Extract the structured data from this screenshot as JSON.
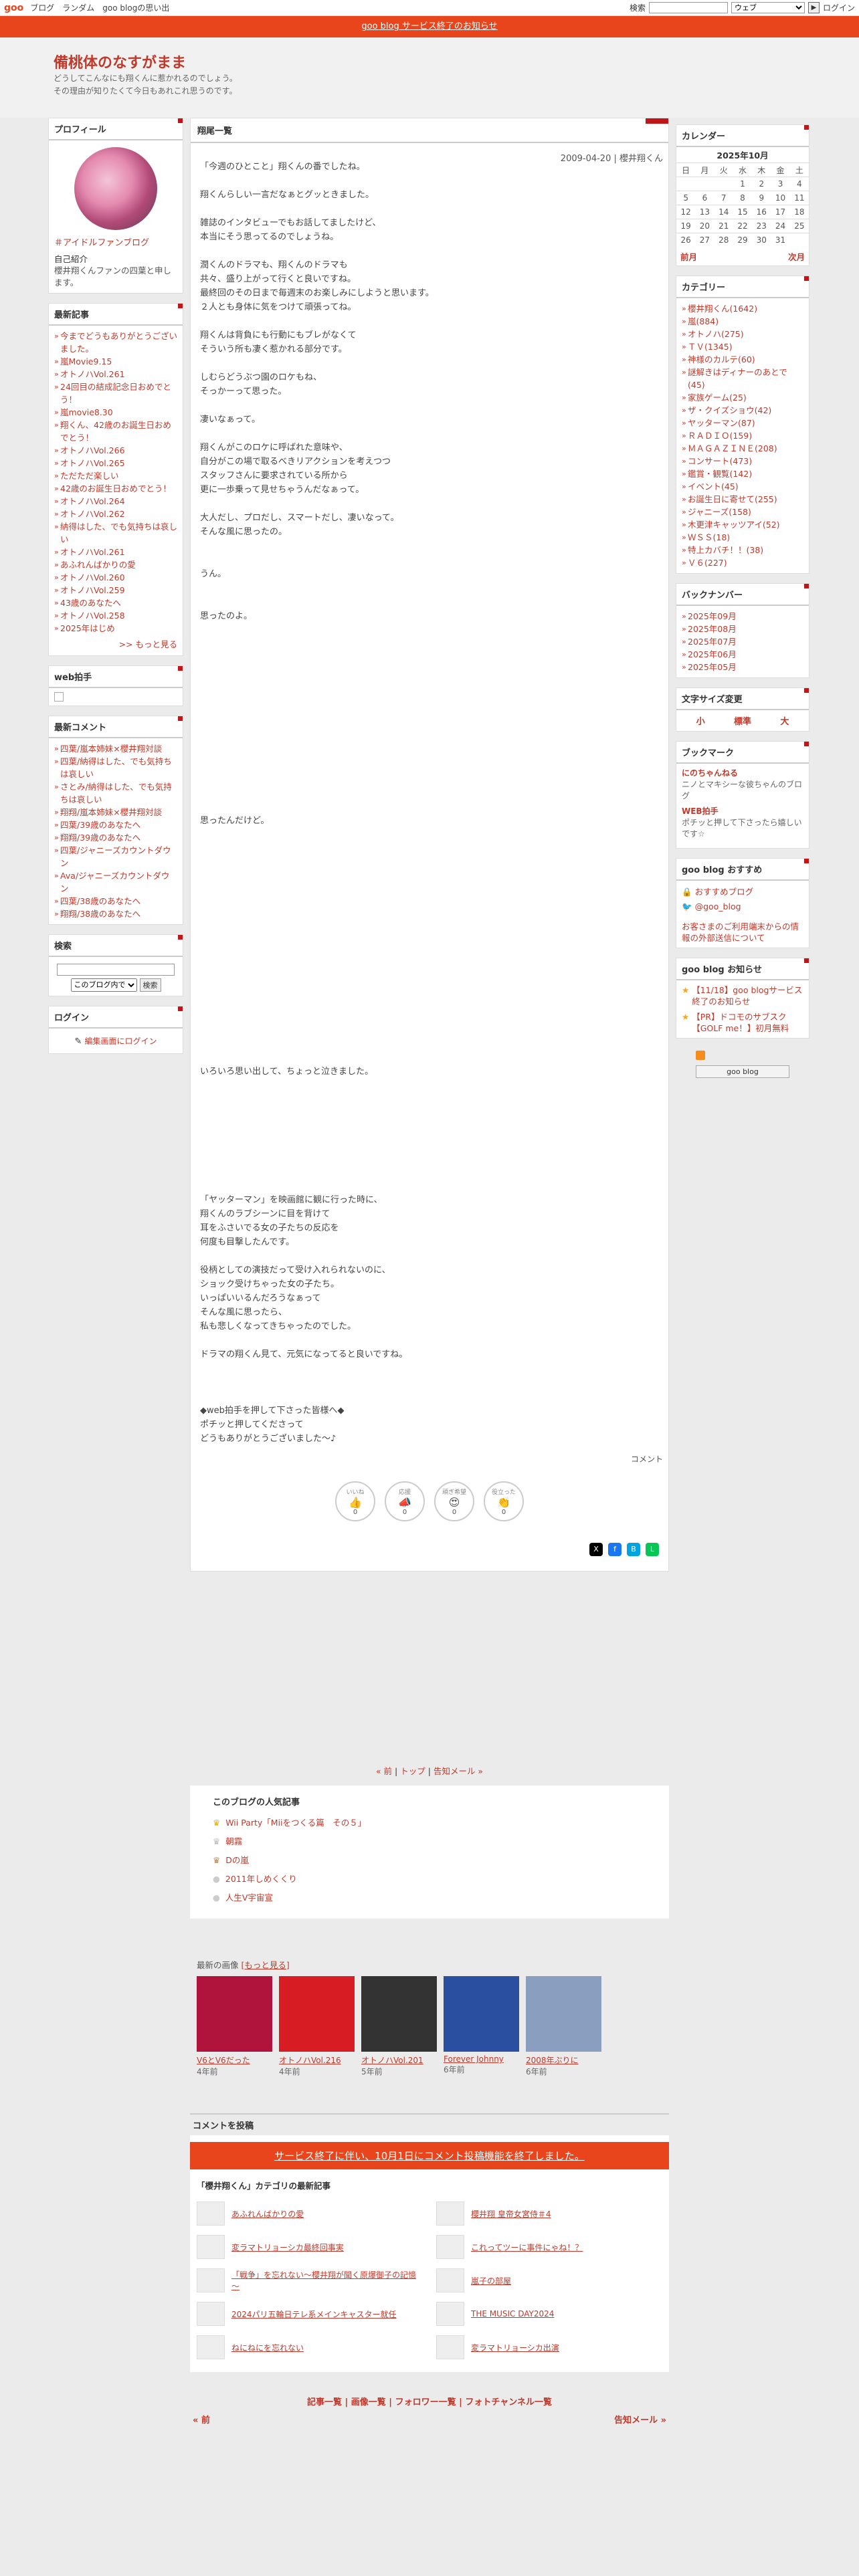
{
  "topbar": {
    "logo": "goo",
    "links": [
      "ブログ",
      "ランダム",
      "goo blogの思い出"
    ],
    "search_label": "検索",
    "search_scope": "ウェブ",
    "go": "▶",
    "login": "ログイン"
  },
  "notice": "goo blog サービス終了のお知らせ",
  "blog": {
    "title": "備桃体のなすがまま",
    "desc1": "どうしてこんなにも翔くんに惹かれるのでしょう。",
    "desc2": "その理由が知りたくて今日もあれこれ思うのです。"
  },
  "profile": {
    "heading": "プロフィール",
    "link": "＃アイドルファンブログ",
    "intro_label": "自己紹介",
    "intro": "櫻井翔くんファンの四葉と申します。"
  },
  "recent": {
    "heading": "最新記事",
    "items": [
      "今までどうもありがとうございました。",
      "嵐Movie9.15",
      "オトノハVol.261",
      "24回目の結成記念日おめでとう！",
      "嵐movie8.30",
      "翔くん、42歳のお誕生日おめでとう！",
      "オトノハVol.266",
      "オトノハVol.265",
      "ただただ楽しい",
      "42歳のお誕生日おめでとう！",
      "オトノハVol.264",
      "オトノハVol.262",
      "納得はした、でも気持ちは哀しい",
      "オトノハVol.261",
      "あふれんばかりの愛",
      "オトノハVol.260",
      "オトノハVol.259",
      "43歳のあなたへ",
      "オトノハVol.258",
      "2025年はじめ"
    ],
    "more": ">> もっと見る"
  },
  "webclap": {
    "heading": "web拍手"
  },
  "comments": {
    "heading": "最新コメント",
    "items": [
      "四葉/嵐本姉妹×櫻井翔対談",
      "四葉/納得はした、でも気持ちは哀しい",
      "さとみ/納得はした、でも気持ちは哀しい",
      "翔翔/嵐本姉妹×櫻井翔対談",
      "四葉/39歳のあなたへ",
      "翔翔/39歳のあなたへ",
      "四葉/ジャニーズカウントダウン",
      "Ava/ジャニーズカウントダウン",
      "四葉/38歳のあなたへ",
      "翔翔/38歳のあなたへ"
    ]
  },
  "search": {
    "heading": "検索",
    "select": "このブログ内で",
    "button": "検索"
  },
  "login": {
    "heading": "ログイン",
    "link": "編集画面にログイン"
  },
  "main": {
    "heading": "翔尾一覧",
    "date": "2009-04-20 | 櫻井翔くん",
    "p1": "「今週のひとこと」翔くんの番でしたね。\n\n翔くんらしい一言だなぁとグッときました。\n\n雑誌のインタビューでもお話してましたけど、\n本当にそう思ってるのでしょうね。\n\n潤くんのドラマも、翔くんのドラマも\n共々、盛り上がって行くと良いですね。\n最終回のその日まで毎週末のお楽しみにしようと思います。\n２人とも身体に気をつけて頑張ってね。\n\n翔くんは背負にも行動にもブレがなくて\nそういう所も凄く惹かれる部分です。\n\nしむらどうぶつ園のロケもね、\nそっかーって思った。\n\n凄いなぁって。\n\n翔くんがこのロケに呼ばれた意味や、\n自分がこの場で取るべきリアクションを考えつつ\nスタッフさんに要求されている所から\n更に一歩乗って見せちゃうんだなぁって。\n\n大人だし、プロだし、スマートだし、凄いなって。\nそんな風に思ったの。\n\n\nうん。\n\n\n思ったのよ。",
    "p2": "思ったんだけど。",
    "p3": "いろいろ思い出して、ちょっと泣きました。",
    "p4": "「ヤッターマン」を映画館に観に行った時に、\n翔くんのラブシーンに目を背けて\n耳をふさいでる女の子たちの反応を\n何度も目撃したんです。\n\n役柄としての演技だって受け入れられないのに、\nショック受けちゃった女の子たち。\nいっぱいいるんだろうなぁって\nそんな風に思ったら、\n私も悲しくなってきちゃったのでした。\n\nドラマの翔くん見て、元気になってると良いですね。\n\n\n\n◆web拍手を押して下さった皆様へ◆\nポチッと押してくださって\nどうもありがとうございました～♪",
    "comment_link": "コメント",
    "reactions": [
      {
        "label": "いいね",
        "icon": "👍",
        "count": "0"
      },
      {
        "label": "応援",
        "icon": "📣",
        "count": "0"
      },
      {
        "label": "頑ぎ希望",
        "icon": "😍",
        "count": "0"
      },
      {
        "label": "役立った",
        "icon": "👏",
        "count": "0"
      }
    ]
  },
  "pager": {
    "prev": "« 前",
    "top": "トップ",
    "next": "告知メール »",
    "sep": "|"
  },
  "popular": {
    "heading": "このブログの人気記事",
    "items": [
      "Wii Party「Miiをつくる篇　その５」",
      "朝霧",
      "Dの嵐",
      "2011年しめくくり",
      "人生V宇宙宣"
    ]
  },
  "images": {
    "heading": "最新の画像",
    "more": "[もっと見る]",
    "items": [
      {
        "cap": "V6とV6だった",
        "ago": "4年前",
        "color": "#b0143c"
      },
      {
        "cap": "オトノハVol.216",
        "ago": "4年前",
        "color": "#d81c24"
      },
      {
        "cap": "オトノハVol.201",
        "ago": "5年前",
        "color": "#333333"
      },
      {
        "cap": "Forever Johnny",
        "ago": "6年前",
        "color": "#2a4fa0"
      },
      {
        "cap": "2008年ぶりに",
        "ago": "6年前",
        "color": "#8a9ec0"
      }
    ]
  },
  "comment_form": {
    "heading": "コメントを投稿",
    "closed": "サービス終了に伴い、10月1日にコメント投稿機能を終了しました。"
  },
  "category": {
    "heading": "「櫻井翔くん」カテゴリの最新記事",
    "items": [
      "あふれんばかりの愛",
      "櫻井翔 皇帝女宮侍＃4",
      "変ラマトリョーシカ最終回事実",
      "これってツーに事件にゃね！？",
      "「戦争」を忘れない～櫻井翔が聞く原爆御子の記憶～",
      "嵐子の部屋",
      "2024パリ五輪日テレ系メインキャスター就任",
      "THE MUSIC DAY2024",
      "ねにねにを忘れない",
      "変ラマトリョーシカ出演"
    ]
  },
  "footnav": "記事一覧 | 画像一覧 | フォロワー一覧 | フォトチャンネル一覧",
  "footpager": {
    "prev": "« 前",
    "next": "告知メール »"
  },
  "calendar": {
    "heading": "カレンダー",
    "month": "2025年10月",
    "days": [
      "日",
      "月",
      "火",
      "水",
      "木",
      "金",
      "土"
    ],
    "weeks": [
      [
        "",
        "",
        "",
        "1",
        "2",
        "3",
        "4"
      ],
      [
        "5",
        "6",
        "7",
        "8",
        "9",
        "10",
        "11"
      ],
      [
        "12",
        "13",
        "14",
        "15",
        "16",
        "17",
        "18"
      ],
      [
        "19",
        "20",
        "21",
        "22",
        "23",
        "24",
        "25"
      ],
      [
        "26",
        "27",
        "28",
        "29",
        "30",
        "31",
        ""
      ]
    ],
    "prev": "前月",
    "next": "次月"
  },
  "categories": {
    "heading": "カテゴリー",
    "items": [
      "櫻井翔くん(1642)",
      "嵐(884)",
      "オトノハ(275)",
      "ＴＶ(1345)",
      "神様のカルテ(60)",
      "謎解きはディナーのあとで(45)",
      "家族ゲーム(25)",
      "ザ・クイズショウ(42)",
      "ヤッターマン(87)",
      "ＲＡＤＩＯ(159)",
      "ＭＡＧＡＺＩＮＥ(208)",
      "コンサート(473)",
      "鑑賞・観覧(142)",
      "イベント(45)",
      "お誕生日に寄せて(255)",
      "ジャニーズ(158)",
      "木更津キャッツアイ(52)",
      "ＷＳＳ(18)",
      "特上カバチ！！(38)",
      "Ｖ６(227)"
    ]
  },
  "backnumber": {
    "heading": "バックナンバー",
    "items": [
      "2025年09月",
      "2025年08月",
      "2025年07月",
      "2025年06月",
      "2025年05月"
    ]
  },
  "fontsize": {
    "heading": "文字サイズ変更",
    "small": "小",
    "normal": "標準",
    "large": "大"
  },
  "bookmark": {
    "heading": "ブックマーク",
    "items": [
      {
        "t": "にのちゃんねる",
        "d": "ニノとマキシーな彼ちゃんのブログ"
      },
      {
        "t": "WEB拍手",
        "d": "ポチッと押して下さったら嬉しいです☆"
      }
    ]
  },
  "goo_rec": {
    "heading": "goo blog おすすめ",
    "items": [
      "おすすめブログ",
      "@goo_blog"
    ],
    "notice": "お客さまのご利用端末からの情報の外部送信について"
  },
  "goo_news": {
    "heading": "goo blog お知らせ",
    "items": [
      "【11/18】goo blogサービス終了のお知らせ",
      "【PR】ドコモのサブスク【GOLF me！】初月無料"
    ]
  },
  "goo_btn": "goo blog"
}
